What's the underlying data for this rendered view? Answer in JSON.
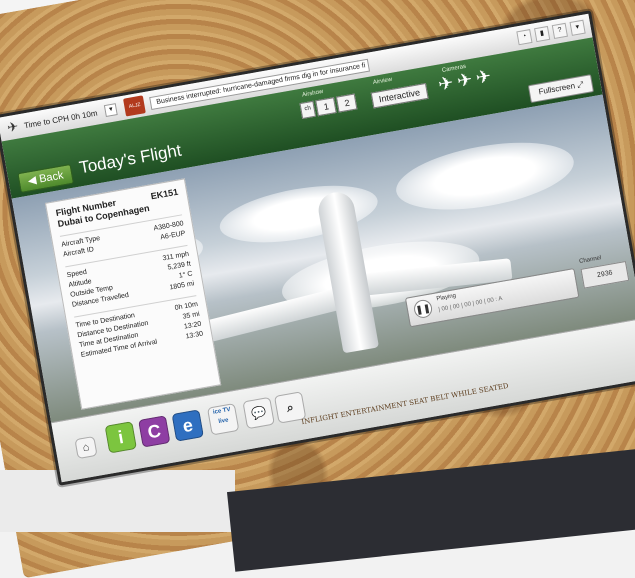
{
  "topbar": {
    "time_to": "Time to CPH",
    "time_value": "0h 10m",
    "news_source": "ALJZ",
    "ticker": "Business interrupted: hurricane-damaged firms dig in for insurance fi"
  },
  "header": {
    "back_label": "Back",
    "title": "Today's Flight",
    "airshow_label": "Airshow",
    "airshow_options": [
      "ch",
      "1",
      "2"
    ],
    "airview_label": "Airview",
    "airview_value": "Interactive",
    "cameras_label": "Cameras",
    "fullscreen_label": "Fullscreen"
  },
  "info": {
    "flight_number_label": "Flight Number",
    "flight_number": "EK151",
    "route": "Dubai to Copenhagen",
    "aircraft_type_label": "Aircraft Type",
    "aircraft_type": "A380-800",
    "aircraft_id_label": "Aircraft ID",
    "aircraft_id": "A6-EUP",
    "speed_label": "Speed",
    "speed": "311 mph",
    "altitude_label": "Altitude",
    "altitude": "5,239 ft",
    "outside_temp_label": "Outside Temp",
    "outside_temp": "1° C",
    "distance_travelled_label": "Distance Travelled",
    "distance_travelled": "1805 mi",
    "time_to_dest_label": "Time to Destination",
    "time_to_dest": "0h 10m",
    "distance_to_dest_label": "Distance to Destination",
    "distance_to_dest": "35 mi",
    "time_at_dest_label": "Time at Destination",
    "time_at_dest": "13:20",
    "eta_label": "Estimated Time of Arrival",
    "eta": "13:30"
  },
  "player": {
    "label": "Playing",
    "time": "| 00 | 00 | 00 | 00 | 00 : A",
    "channel_label": "Channel",
    "channel_value": "2936"
  },
  "bottom": {
    "i_label": "i",
    "c_label": "C",
    "e_label": "e",
    "tv_label": "ice TV live"
  },
  "wood_text": "INFLIGHT ENTERTAINMENT SEAT BELT WHILE SEATED"
}
